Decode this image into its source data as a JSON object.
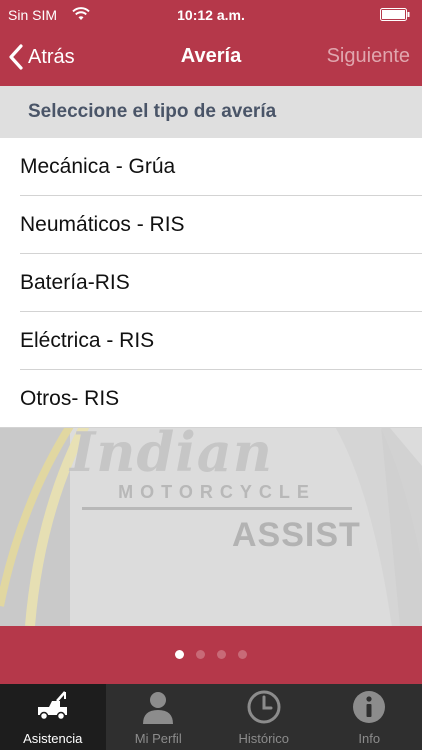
{
  "status_bar": {
    "carrier": "Sin SIM",
    "time": "10:12 a.m."
  },
  "nav": {
    "back_label": "Atrás",
    "title": "Avería",
    "next_label": "Siguiente"
  },
  "prompt": "Seleccione el tipo de avería",
  "breakdown_types": [
    "Mecánica - Grúa",
    "Neumáticos - RIS",
    "Batería-RIS",
    "Eléctrica - RIS",
    "Otros- RIS"
  ],
  "logo": {
    "script": "Indian",
    "brand": "MOTORCYCLE",
    "product": "ASSIST"
  },
  "pager": {
    "page_count": 4,
    "active_page": 1
  },
  "tabs": [
    {
      "label": "Asistencia",
      "icon": "tow-truck-icon",
      "active": true
    },
    {
      "label": "Mi Perfil",
      "icon": "user-icon",
      "active": false
    },
    {
      "label": "Histórico",
      "icon": "clock-icon",
      "active": false
    },
    {
      "label": "Info",
      "icon": "info-icon",
      "active": false
    }
  ],
  "colors": {
    "brand": "#b5384a",
    "tab_bar": "#2f2f2f",
    "next_disabled": "#e0a6ae"
  }
}
